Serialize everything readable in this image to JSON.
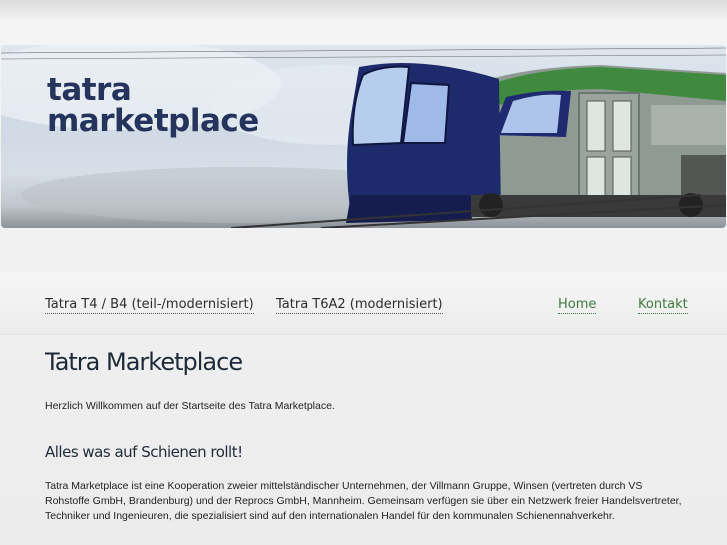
{
  "header": {
    "logo_line1": "tatra",
    "logo_line2": "marketplace"
  },
  "nav": {
    "items": [
      {
        "label": "Tatra T4 / B4 (teil-/modernisiert)"
      },
      {
        "label": "Tatra T6A2 (modernisiert)"
      },
      {
        "label": "Home"
      },
      {
        "label": "Kontakt"
      }
    ]
  },
  "main": {
    "title": "Tatra Marketplace",
    "intro": "Herzlich Willkommen auf der Startseite des Tatra Marketplace.",
    "subtitle": "Alles was auf Schienen rollt!",
    "paragraph": "Tatra Marketplace ist eine Kooperation zweier mittelständischer Unternehmen, der Villmann Gruppe, Winsen (vertreten durch VS Rohstoffe GmbH, Brandenburg) und der Reprocs GmbH, Mannheim. Gemeinsam verfügen sie über ein Netzwerk freier Handelsvertreter, Techniker und Ingenieuren, die spezialisiert sind auf den internationalen Handel für den kommunalen Schienennahverkehr."
  },
  "colors": {
    "logo": "#24345c",
    "nav_active": "#3c7a3c",
    "tram_blue": "#1d2a6b",
    "tram_green": "#3f8a3f"
  }
}
